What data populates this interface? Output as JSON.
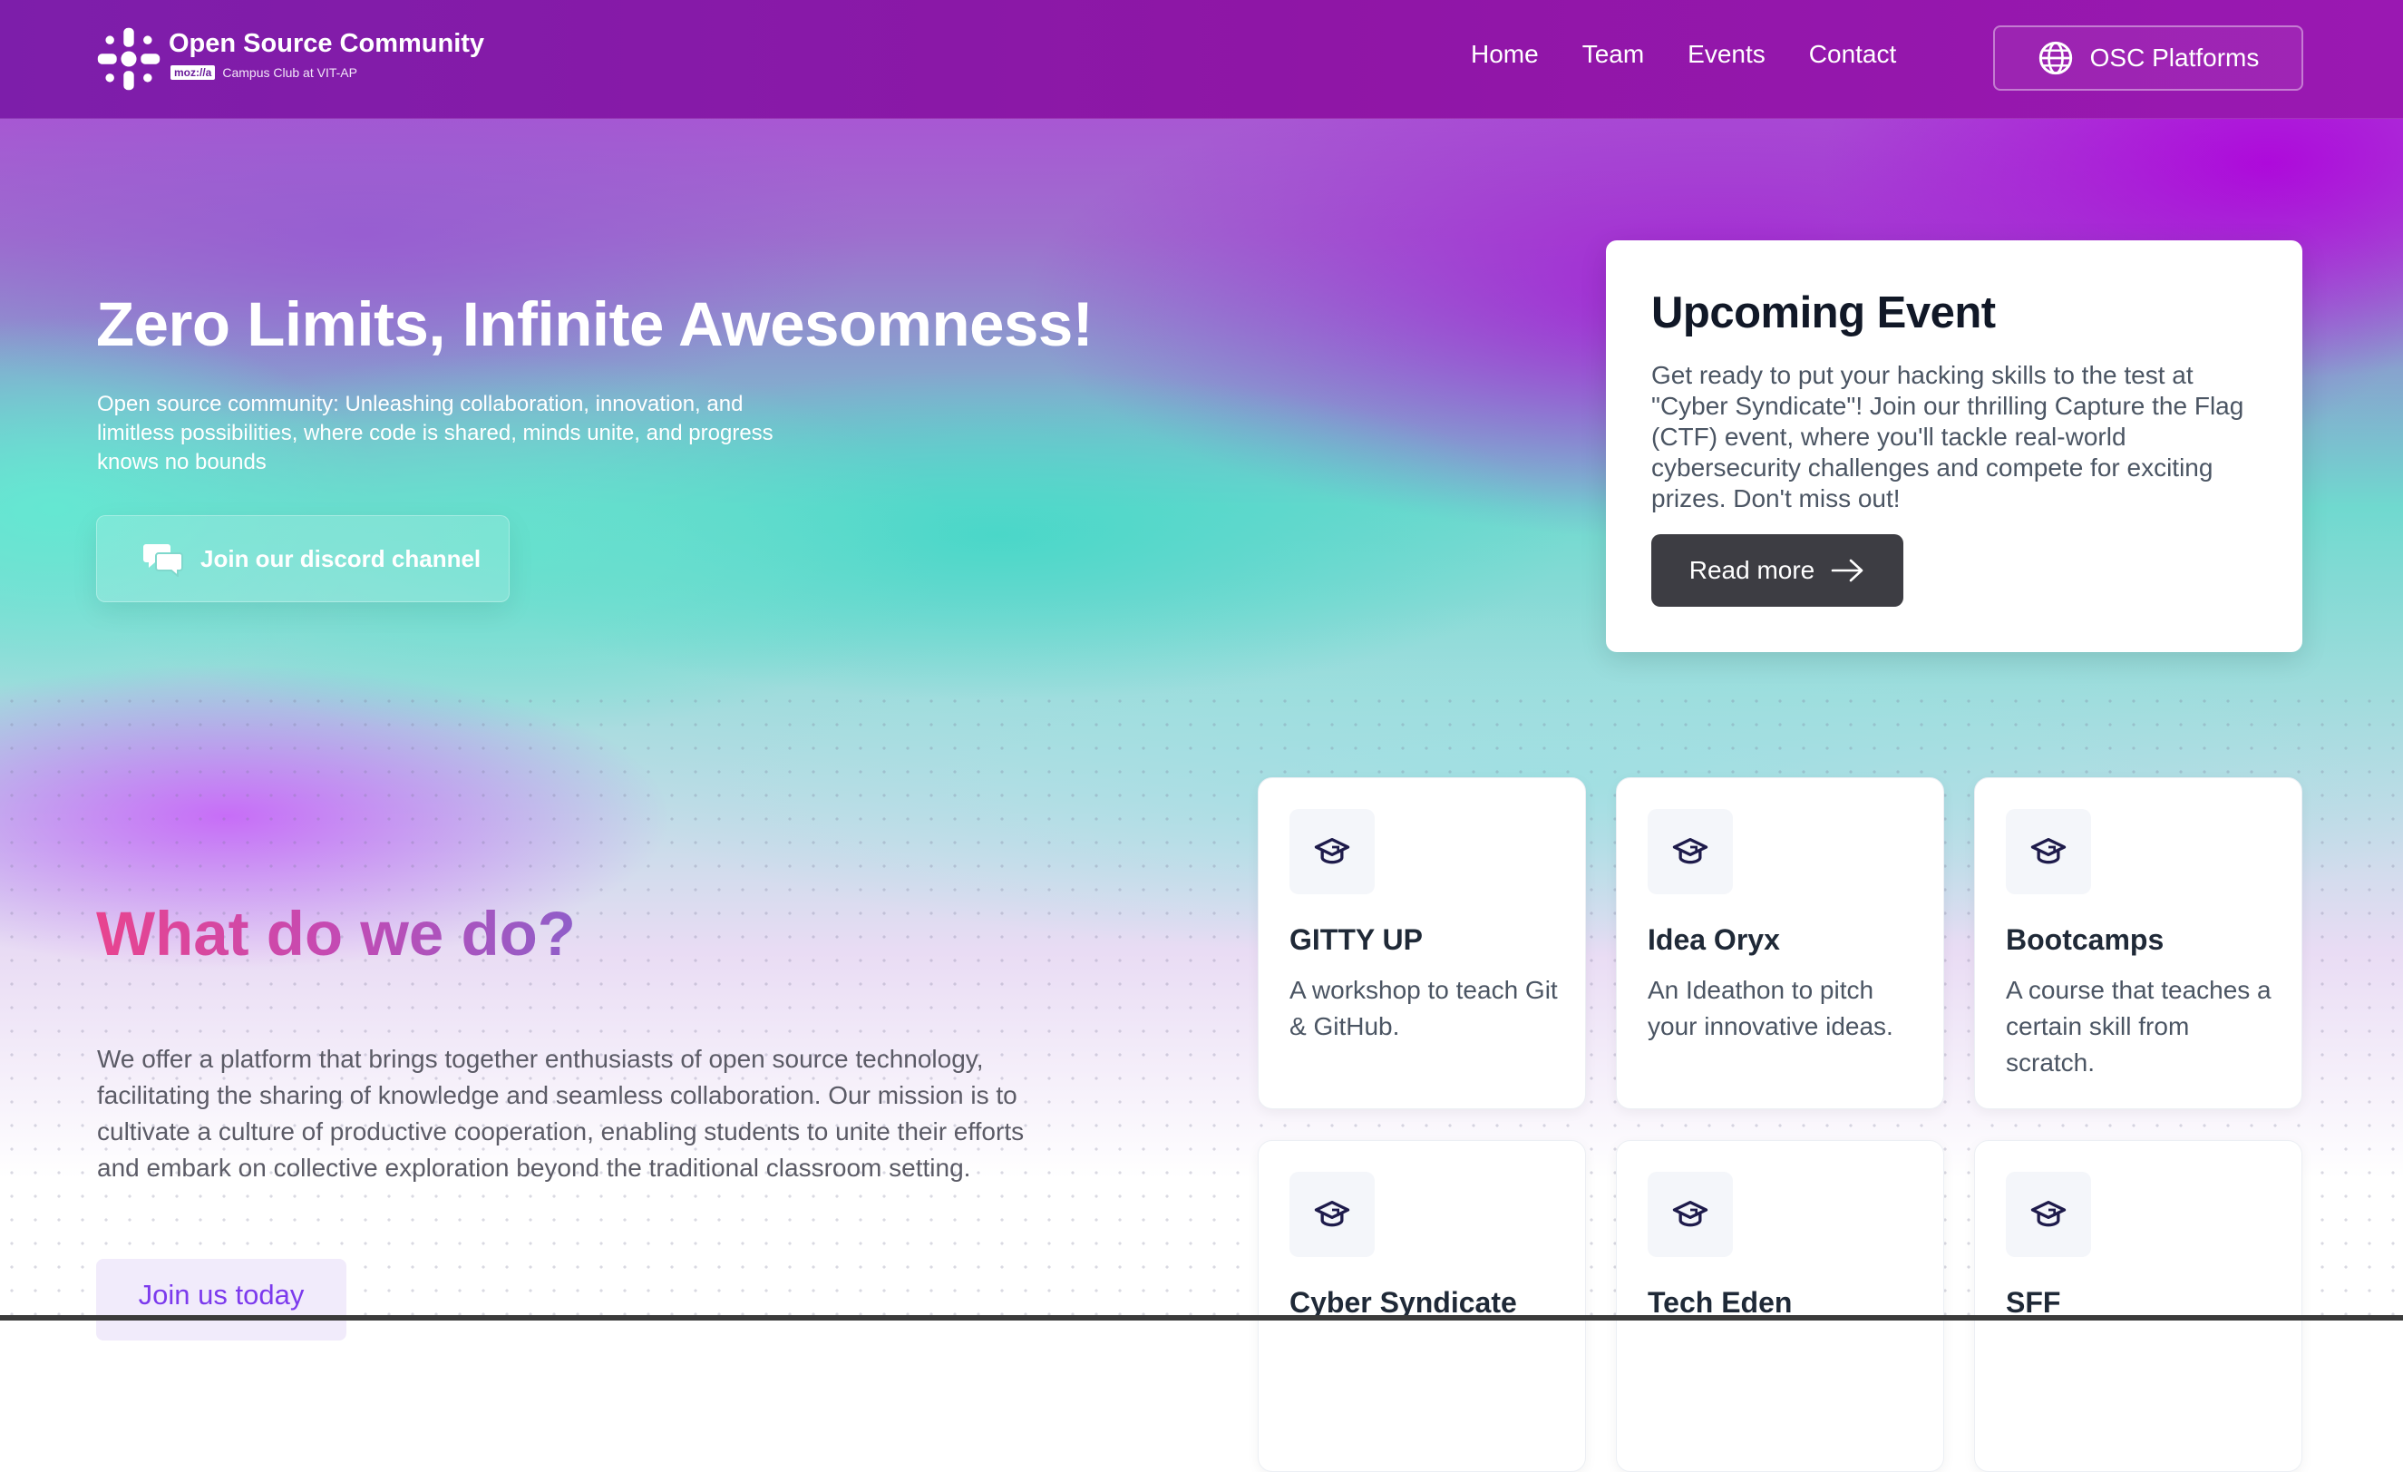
{
  "header": {
    "brand_title": "Open Source Community",
    "brand_badge": "moz://a",
    "brand_subtitle": "Campus Club at VIT-AP",
    "nav": [
      "Home",
      "Team",
      "Events",
      "Contact"
    ],
    "platforms_label": "OSC Platforms"
  },
  "hero": {
    "title": "Zero Limits, Infinite Awesomness!",
    "text": "Open source community: Unleashing collaboration, innovation, and limitless possibilities, where code is shared, minds unite, and progress knows no bounds",
    "discord_label": "Join our discord channel"
  },
  "event": {
    "title": "Upcoming Event",
    "description": "Get ready to put your hacking skills to the test at \"Cyber Syndicate\"! Join our thrilling Capture the Flag (CTF) event, where you'll tackle real-world cybersecurity challenges and compete for exciting prizes. Don't miss out!",
    "read_more": "Read more"
  },
  "what": {
    "title": "What do we do?",
    "text": "We offer a platform that brings together enthusiasts of open source technology, facilitating the sharing of knowledge and seamless collaboration. Our mission is to cultivate a culture of productive cooperation, enabling students to unite their efforts and embark on collective exploration beyond the traditional classroom setting.",
    "join_label": "Join us today"
  },
  "activities": [
    {
      "title": "GITTY UP",
      "desc": "A workshop to teach Git & GitHub."
    },
    {
      "title": "Idea Oryx",
      "desc": "An Ideathon to pitch your innovative ideas."
    },
    {
      "title": "Bootcamps",
      "desc": "A course that teaches a certain skill from scratch."
    },
    {
      "title": "Cyber Syndicate",
      "desc": ""
    },
    {
      "title": "Tech Eden",
      "desc": ""
    },
    {
      "title": "SFF",
      "desc": ""
    }
  ],
  "icons": {
    "logo": "osc-logo-icon",
    "platforms": "globe-icon",
    "discord": "chat-bubbles-icon",
    "read_more": "arrow-right-icon",
    "activity": "graduation-cap-icon"
  },
  "colors": {
    "header": "#8f16a6",
    "dark_button": "#3d3d43",
    "accent_purple": "#7c3aed",
    "title_pink": "#e8448f",
    "icon_navy": "#1e1b4b"
  }
}
